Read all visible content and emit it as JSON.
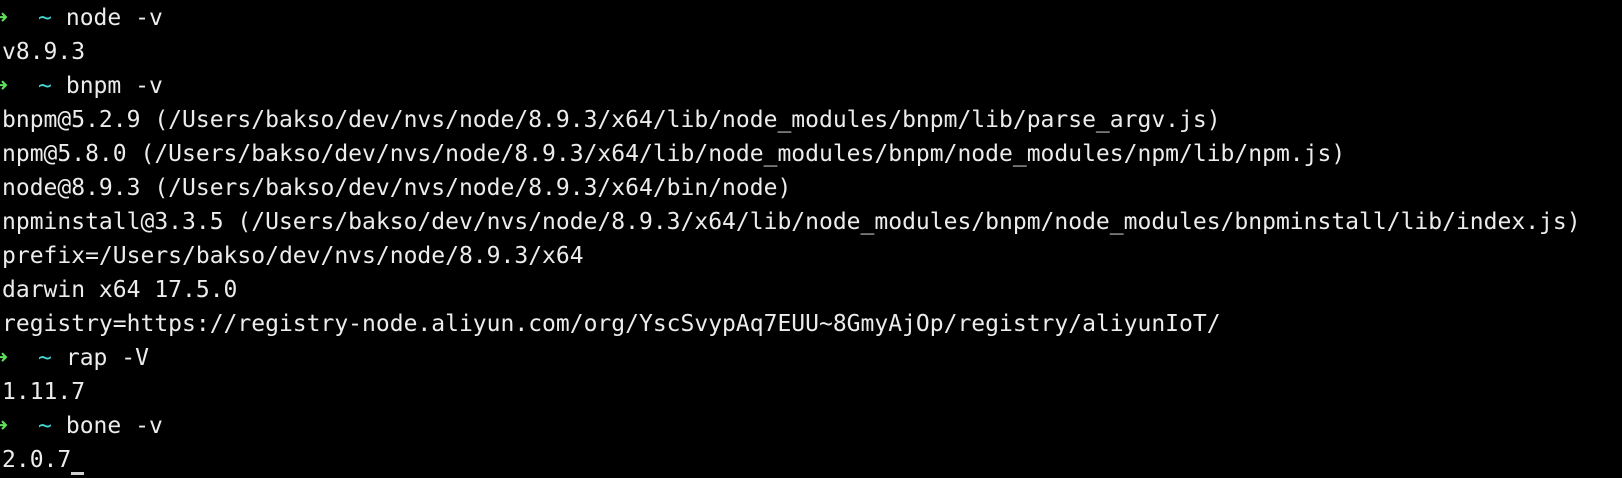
{
  "colors": {
    "background": "#000000",
    "text": "#ececec",
    "prompt_arrow": "#5ee05e",
    "prompt_tilde": "#45d6d6"
  },
  "prompt": {
    "arrow_icon": "right-arrow-icon",
    "arrow": "➜",
    "dir": "~"
  },
  "lines": {
    "l0": {
      "command": "node -v"
    },
    "l1": {
      "text": "v8.9.3"
    },
    "l2": {
      "command": "bnpm -v"
    },
    "l3": {
      "text": "bnpm@5.2.9 (/Users/bakso/dev/nvs/node/8.9.3/x64/lib/node_modules/bnpm/lib/parse_argv.js)"
    },
    "l4": {
      "text": "npm@5.8.0 (/Users/bakso/dev/nvs/node/8.9.3/x64/lib/node_modules/bnpm/node_modules/npm/lib/npm.js)"
    },
    "l5": {
      "text": "node@8.9.3 (/Users/bakso/dev/nvs/node/8.9.3/x64/bin/node)"
    },
    "l6": {
      "text": "npminstall@3.3.5 (/Users/bakso/dev/nvs/node/8.9.3/x64/lib/node_modules/bnpm/node_modules/bnpminstall/lib/index.js)"
    },
    "l7": {
      "text": "prefix=/Users/bakso/dev/nvs/node/8.9.3/x64"
    },
    "l8": {
      "text": "darwin x64 17.5.0"
    },
    "l9": {
      "text": "registry=https://registry-node.aliyun.com/org/YscSvypAq7EUU~8GmyAjOp/registry/aliyunIoT/"
    },
    "l10": {
      "command": "rap -V"
    },
    "l11": {
      "text": "1.11.7"
    },
    "l12": {
      "command": "bone -v"
    },
    "l13": {
      "text": "2.0.7"
    }
  }
}
